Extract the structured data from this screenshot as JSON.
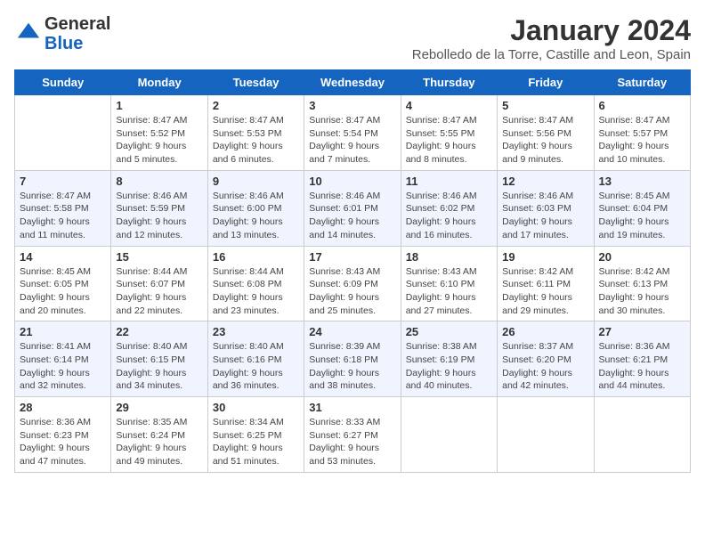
{
  "header": {
    "logo_line1": "General",
    "logo_line2": "Blue",
    "main_title": "January 2024",
    "subtitle": "Rebolledo de la Torre, Castille and Leon, Spain"
  },
  "weekdays": [
    "Sunday",
    "Monday",
    "Tuesday",
    "Wednesday",
    "Thursday",
    "Friday",
    "Saturday"
  ],
  "weeks": [
    [
      {
        "day": "",
        "sunrise": "",
        "sunset": "",
        "daylight": ""
      },
      {
        "day": "1",
        "sunrise": "Sunrise: 8:47 AM",
        "sunset": "Sunset: 5:52 PM",
        "daylight": "Daylight: 9 hours and 5 minutes."
      },
      {
        "day": "2",
        "sunrise": "Sunrise: 8:47 AM",
        "sunset": "Sunset: 5:53 PM",
        "daylight": "Daylight: 9 hours and 6 minutes."
      },
      {
        "day": "3",
        "sunrise": "Sunrise: 8:47 AM",
        "sunset": "Sunset: 5:54 PM",
        "daylight": "Daylight: 9 hours and 7 minutes."
      },
      {
        "day": "4",
        "sunrise": "Sunrise: 8:47 AM",
        "sunset": "Sunset: 5:55 PM",
        "daylight": "Daylight: 9 hours and 8 minutes."
      },
      {
        "day": "5",
        "sunrise": "Sunrise: 8:47 AM",
        "sunset": "Sunset: 5:56 PM",
        "daylight": "Daylight: 9 hours and 9 minutes."
      },
      {
        "day": "6",
        "sunrise": "Sunrise: 8:47 AM",
        "sunset": "Sunset: 5:57 PM",
        "daylight": "Daylight: 9 hours and 10 minutes."
      }
    ],
    [
      {
        "day": "7",
        "sunrise": "Sunrise: 8:47 AM",
        "sunset": "Sunset: 5:58 PM",
        "daylight": "Daylight: 9 hours and 11 minutes."
      },
      {
        "day": "8",
        "sunrise": "Sunrise: 8:46 AM",
        "sunset": "Sunset: 5:59 PM",
        "daylight": "Daylight: 9 hours and 12 minutes."
      },
      {
        "day": "9",
        "sunrise": "Sunrise: 8:46 AM",
        "sunset": "Sunset: 6:00 PM",
        "daylight": "Daylight: 9 hours and 13 minutes."
      },
      {
        "day": "10",
        "sunrise": "Sunrise: 8:46 AM",
        "sunset": "Sunset: 6:01 PM",
        "daylight": "Daylight: 9 hours and 14 minutes."
      },
      {
        "day": "11",
        "sunrise": "Sunrise: 8:46 AM",
        "sunset": "Sunset: 6:02 PM",
        "daylight": "Daylight: 9 hours and 16 minutes."
      },
      {
        "day": "12",
        "sunrise": "Sunrise: 8:46 AM",
        "sunset": "Sunset: 6:03 PM",
        "daylight": "Daylight: 9 hours and 17 minutes."
      },
      {
        "day": "13",
        "sunrise": "Sunrise: 8:45 AM",
        "sunset": "Sunset: 6:04 PM",
        "daylight": "Daylight: 9 hours and 19 minutes."
      }
    ],
    [
      {
        "day": "14",
        "sunrise": "Sunrise: 8:45 AM",
        "sunset": "Sunset: 6:05 PM",
        "daylight": "Daylight: 9 hours and 20 minutes."
      },
      {
        "day": "15",
        "sunrise": "Sunrise: 8:44 AM",
        "sunset": "Sunset: 6:07 PM",
        "daylight": "Daylight: 9 hours and 22 minutes."
      },
      {
        "day": "16",
        "sunrise": "Sunrise: 8:44 AM",
        "sunset": "Sunset: 6:08 PM",
        "daylight": "Daylight: 9 hours and 23 minutes."
      },
      {
        "day": "17",
        "sunrise": "Sunrise: 8:43 AM",
        "sunset": "Sunset: 6:09 PM",
        "daylight": "Daylight: 9 hours and 25 minutes."
      },
      {
        "day": "18",
        "sunrise": "Sunrise: 8:43 AM",
        "sunset": "Sunset: 6:10 PM",
        "daylight": "Daylight: 9 hours and 27 minutes."
      },
      {
        "day": "19",
        "sunrise": "Sunrise: 8:42 AM",
        "sunset": "Sunset: 6:11 PM",
        "daylight": "Daylight: 9 hours and 29 minutes."
      },
      {
        "day": "20",
        "sunrise": "Sunrise: 8:42 AM",
        "sunset": "Sunset: 6:13 PM",
        "daylight": "Daylight: 9 hours and 30 minutes."
      }
    ],
    [
      {
        "day": "21",
        "sunrise": "Sunrise: 8:41 AM",
        "sunset": "Sunset: 6:14 PM",
        "daylight": "Daylight: 9 hours and 32 minutes."
      },
      {
        "day": "22",
        "sunrise": "Sunrise: 8:40 AM",
        "sunset": "Sunset: 6:15 PM",
        "daylight": "Daylight: 9 hours and 34 minutes."
      },
      {
        "day": "23",
        "sunrise": "Sunrise: 8:40 AM",
        "sunset": "Sunset: 6:16 PM",
        "daylight": "Daylight: 9 hours and 36 minutes."
      },
      {
        "day": "24",
        "sunrise": "Sunrise: 8:39 AM",
        "sunset": "Sunset: 6:18 PM",
        "daylight": "Daylight: 9 hours and 38 minutes."
      },
      {
        "day": "25",
        "sunrise": "Sunrise: 8:38 AM",
        "sunset": "Sunset: 6:19 PM",
        "daylight": "Daylight: 9 hours and 40 minutes."
      },
      {
        "day": "26",
        "sunrise": "Sunrise: 8:37 AM",
        "sunset": "Sunset: 6:20 PM",
        "daylight": "Daylight: 9 hours and 42 minutes."
      },
      {
        "day": "27",
        "sunrise": "Sunrise: 8:36 AM",
        "sunset": "Sunset: 6:21 PM",
        "daylight": "Daylight: 9 hours and 44 minutes."
      }
    ],
    [
      {
        "day": "28",
        "sunrise": "Sunrise: 8:36 AM",
        "sunset": "Sunset: 6:23 PM",
        "daylight": "Daylight: 9 hours and 47 minutes."
      },
      {
        "day": "29",
        "sunrise": "Sunrise: 8:35 AM",
        "sunset": "Sunset: 6:24 PM",
        "daylight": "Daylight: 9 hours and 49 minutes."
      },
      {
        "day": "30",
        "sunrise": "Sunrise: 8:34 AM",
        "sunset": "Sunset: 6:25 PM",
        "daylight": "Daylight: 9 hours and 51 minutes."
      },
      {
        "day": "31",
        "sunrise": "Sunrise: 8:33 AM",
        "sunset": "Sunset: 6:27 PM",
        "daylight": "Daylight: 9 hours and 53 minutes."
      },
      {
        "day": "",
        "sunrise": "",
        "sunset": "",
        "daylight": ""
      },
      {
        "day": "",
        "sunrise": "",
        "sunset": "",
        "daylight": ""
      },
      {
        "day": "",
        "sunrise": "",
        "sunset": "",
        "daylight": ""
      }
    ]
  ]
}
